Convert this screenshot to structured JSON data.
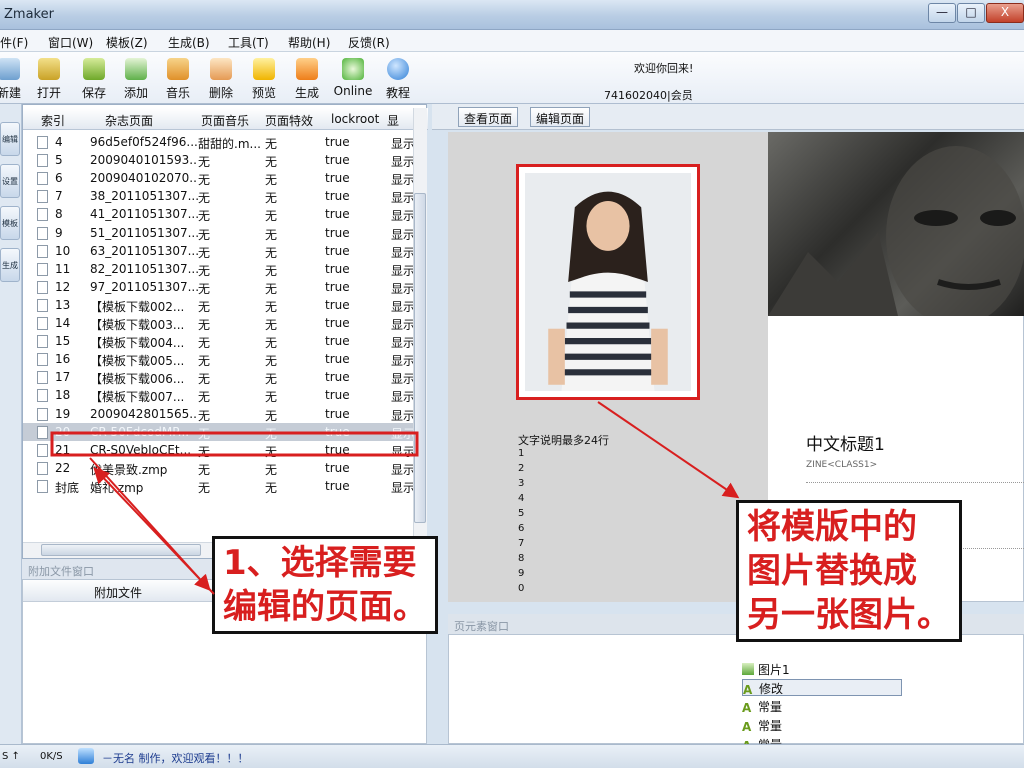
{
  "window": {
    "title": "Zmaker",
    "min": "—",
    "max": "□",
    "close": "X"
  },
  "menu": [
    "件(F)",
    "窗口(W)",
    "模板(Z)",
    "生成(B)",
    "工具(T)",
    "帮助(H)",
    "反馈(R)"
  ],
  "toolbar": [
    "新建",
    "打开",
    "保存",
    "添加",
    "音乐",
    "删除",
    "预览",
    "生成",
    "Online",
    "教程"
  ],
  "user": {
    "welcome": "欢迎你回来!",
    "member": "741602040|会员"
  },
  "sidebar": [
    "编辑",
    "设置",
    "模板",
    "生成"
  ],
  "list": {
    "columns": [
      "索引",
      "杂志页面",
      "页面音乐",
      "页面特效",
      "lockroot",
      "显"
    ],
    "rows": [
      {
        "idx": "4",
        "page": "96d5ef0f524f96...",
        "music": "甜甜的.m...",
        "effect": "无",
        "lock": "true",
        "show": "显示"
      },
      {
        "idx": "5",
        "page": "2009040101593...",
        "music": "无",
        "effect": "无",
        "lock": "true",
        "show": "显示"
      },
      {
        "idx": "6",
        "page": "2009040102070...",
        "music": "无",
        "effect": "无",
        "lock": "true",
        "show": "显示"
      },
      {
        "idx": "7",
        "page": "38_2011051307...",
        "music": "无",
        "effect": "无",
        "lock": "true",
        "show": "显示"
      },
      {
        "idx": "8",
        "page": "41_2011051307...",
        "music": "无",
        "effect": "无",
        "lock": "true",
        "show": "显示"
      },
      {
        "idx": "9",
        "page": "51_2011051307...",
        "music": "无",
        "effect": "无",
        "lock": "true",
        "show": "显示"
      },
      {
        "idx": "10",
        "page": "63_2011051307...",
        "music": "无",
        "effect": "无",
        "lock": "true",
        "show": "显示"
      },
      {
        "idx": "11",
        "page": "82_2011051307...",
        "music": "无",
        "effect": "无",
        "lock": "true",
        "show": "显示"
      },
      {
        "idx": "12",
        "page": "97_2011051307...",
        "music": "无",
        "effect": "无",
        "lock": "true",
        "show": "显示"
      },
      {
        "idx": "13",
        "page": "【模板下载002...",
        "music": "无",
        "effect": "无",
        "lock": "true",
        "show": "显示"
      },
      {
        "idx": "14",
        "page": "【模板下载003...",
        "music": "无",
        "effect": "无",
        "lock": "true",
        "show": "显示"
      },
      {
        "idx": "15",
        "page": "【模板下载004...",
        "music": "无",
        "effect": "无",
        "lock": "true",
        "show": "显示"
      },
      {
        "idx": "16",
        "page": "【模板下载005...",
        "music": "无",
        "effect": "无",
        "lock": "true",
        "show": "显示"
      },
      {
        "idx": "17",
        "page": "【模板下载006...",
        "music": "无",
        "effect": "无",
        "lock": "true",
        "show": "显示"
      },
      {
        "idx": "18",
        "page": "【模板下载007...",
        "music": "无",
        "effect": "无",
        "lock": "true",
        "show": "显示"
      },
      {
        "idx": "19",
        "page": "2009042801565...",
        "music": "无",
        "effect": "无",
        "lock": "true",
        "show": "显示"
      },
      {
        "idx": "20",
        "page": "CR-50FdcodMP...",
        "music": "无",
        "effect": "无",
        "lock": "true",
        "show": "显示"
      },
      {
        "idx": "21",
        "page": "CR-S0VebIoCEt...",
        "music": "无",
        "effect": "无",
        "lock": "true",
        "show": "显示"
      },
      {
        "idx": "22",
        "page": "优美景致.zmp",
        "music": "无",
        "effect": "无",
        "lock": "true",
        "show": "显示"
      },
      {
        "idx": "封底",
        "page": "婚礼.zmp",
        "music": "无",
        "effect": "无",
        "lock": "true",
        "show": "显示"
      }
    ],
    "selected_index": 16
  },
  "attach": {
    "window_title": "附加文件窗口",
    "header": "附加文件"
  },
  "view": {
    "tab_view": "查看页面",
    "tab_edit": "编辑页面"
  },
  "preview": {
    "caption": "文字说明最多24行",
    "lines": [
      "1",
      "2",
      "3",
      "4",
      "5",
      "6",
      "7",
      "8",
      "9",
      "0"
    ],
    "cn_title": "中文标题1",
    "zine_class": "ZINE<CLASS1>"
  },
  "components": {
    "window_title": "页元素窗口",
    "items": [
      "图片1",
      "修改",
      "常量",
      "常量",
      "常量"
    ]
  },
  "status": {
    "speed_a": "S ↑",
    "speed_b": "0K/S",
    "text": "－无名 制作，欢迎观看！！！"
  },
  "annotations": {
    "a1": [
      "1、选择需要",
      "编辑的页面。"
    ],
    "a2": [
      "将模版中的",
      "图片替换成",
      "另一张图片。"
    ]
  },
  "colors": {
    "accent_red": "#d81f1f",
    "selection": "#c5ccd6"
  }
}
